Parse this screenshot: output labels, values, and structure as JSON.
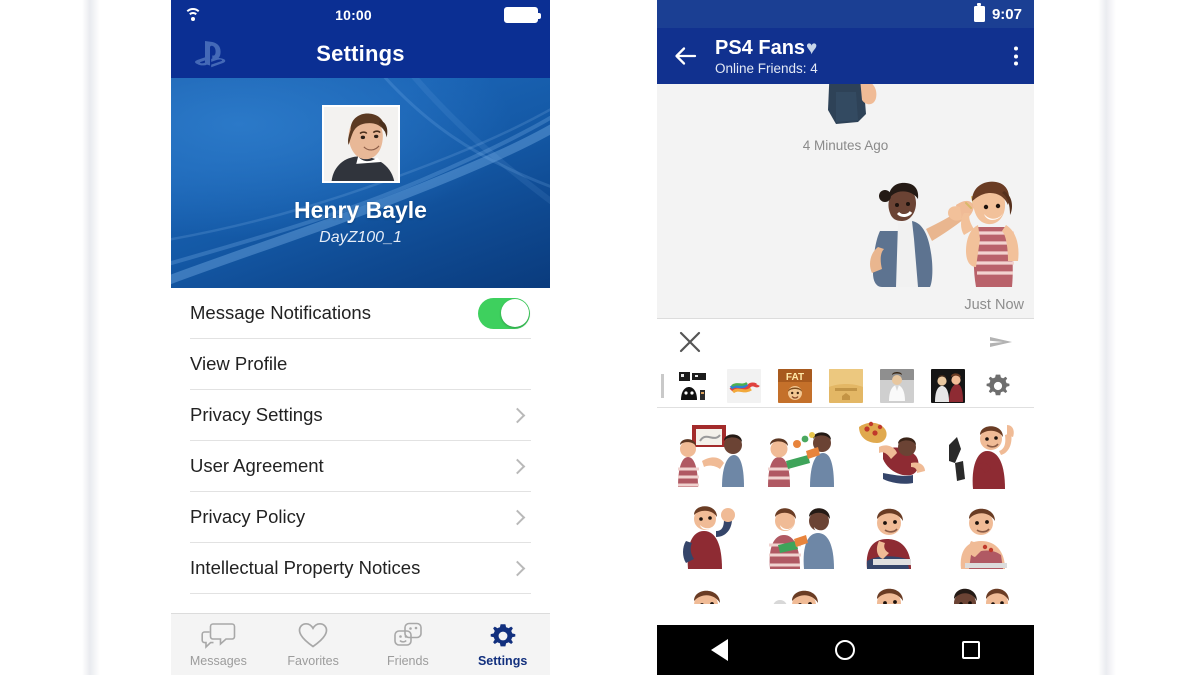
{
  "left_phone": {
    "status_bar": {
      "wifi_icon": "wifi-icon",
      "time": "10:00",
      "battery_icon": "battery-full-icon"
    },
    "app_bar": {
      "logo_icon": "playstation-logo-icon",
      "title": "Settings"
    },
    "profile": {
      "avatar_icon": "user-avatar-photo",
      "display_name": "Henry Bayle",
      "online_id": "DayZ100_1"
    },
    "settings_rows": [
      {
        "label": "Message Notifications",
        "control": "toggle",
        "toggle_on": true
      },
      {
        "label": "View Profile",
        "control": "none"
      },
      {
        "label": "Privacy Settings",
        "control": "chevron"
      },
      {
        "label": "User Agreement",
        "control": "chevron"
      },
      {
        "label": "Privacy Policy",
        "control": "chevron"
      },
      {
        "label": "Intellectual Property Notices",
        "control": "chevron"
      }
    ],
    "tab_bar": [
      {
        "label": "Messages",
        "icon": "chat-bubbles-icon",
        "active": false
      },
      {
        "label": "Favorites",
        "icon": "heart-icon",
        "active": false
      },
      {
        "label": "Friends",
        "icon": "friends-faces-icon",
        "active": false
      },
      {
        "label": "Settings",
        "icon": "gear-icon",
        "active": true
      }
    ]
  },
  "right_phone": {
    "status_bar": {
      "battery_icon": "battery-icon",
      "time": "9:07"
    },
    "app_bar": {
      "back_icon": "arrow-left-icon",
      "title": "PS4 Fans",
      "title_badge": "♥",
      "subtitle": "Online Friends: 4",
      "overflow_icon": "more-vertical-icon"
    },
    "chat": {
      "messages": [
        {
          "type": "sticker",
          "align": "center",
          "timestamp": "4 Minutes Ago",
          "sticker_icon": "sticker-partial-person"
        },
        {
          "type": "sticker",
          "align": "right",
          "timestamp": "Just Now",
          "sticker_icon": "sticker-high-five"
        }
      ]
    },
    "compose": {
      "close_icon": "close-x-icon",
      "send_icon": "send-paper-plane-icon"
    },
    "sticker_packs": [
      {
        "name": "monster-pack",
        "selected": false
      },
      {
        "name": "colorful-scribble-pack",
        "selected": false
      },
      {
        "name": "fat-pack",
        "selected": false
      },
      {
        "name": "gold-legends-pack",
        "selected": false
      },
      {
        "name": "white-suit-pack",
        "selected": false
      },
      {
        "name": "dark-duo-pack",
        "selected": true
      }
    ],
    "sticker_settings_icon": "gear-icon",
    "sticker_grid": [
      "sticker-couple-tv",
      "sticker-water-gun-duo",
      "sticker-pizza-toss",
      "sticker-pointing-up",
      "sticker-cheer-fist",
      "sticker-laughing-duo",
      "sticker-bored-lean",
      "sticker-chin-rest",
      "sticker-pointing-side",
      "sticker-mic-sing",
      "sticker-seated-talk",
      "sticker-hug-pair"
    ],
    "nav_bar": [
      {
        "icon": "android-back-icon"
      },
      {
        "icon": "android-home-icon"
      },
      {
        "icon": "android-recents-icon"
      }
    ]
  },
  "colors": {
    "ps_blue": "#0b2f93",
    "android_blue": "#11318f",
    "toggle_green": "#3ed05e",
    "active_tab": "#12307e"
  }
}
